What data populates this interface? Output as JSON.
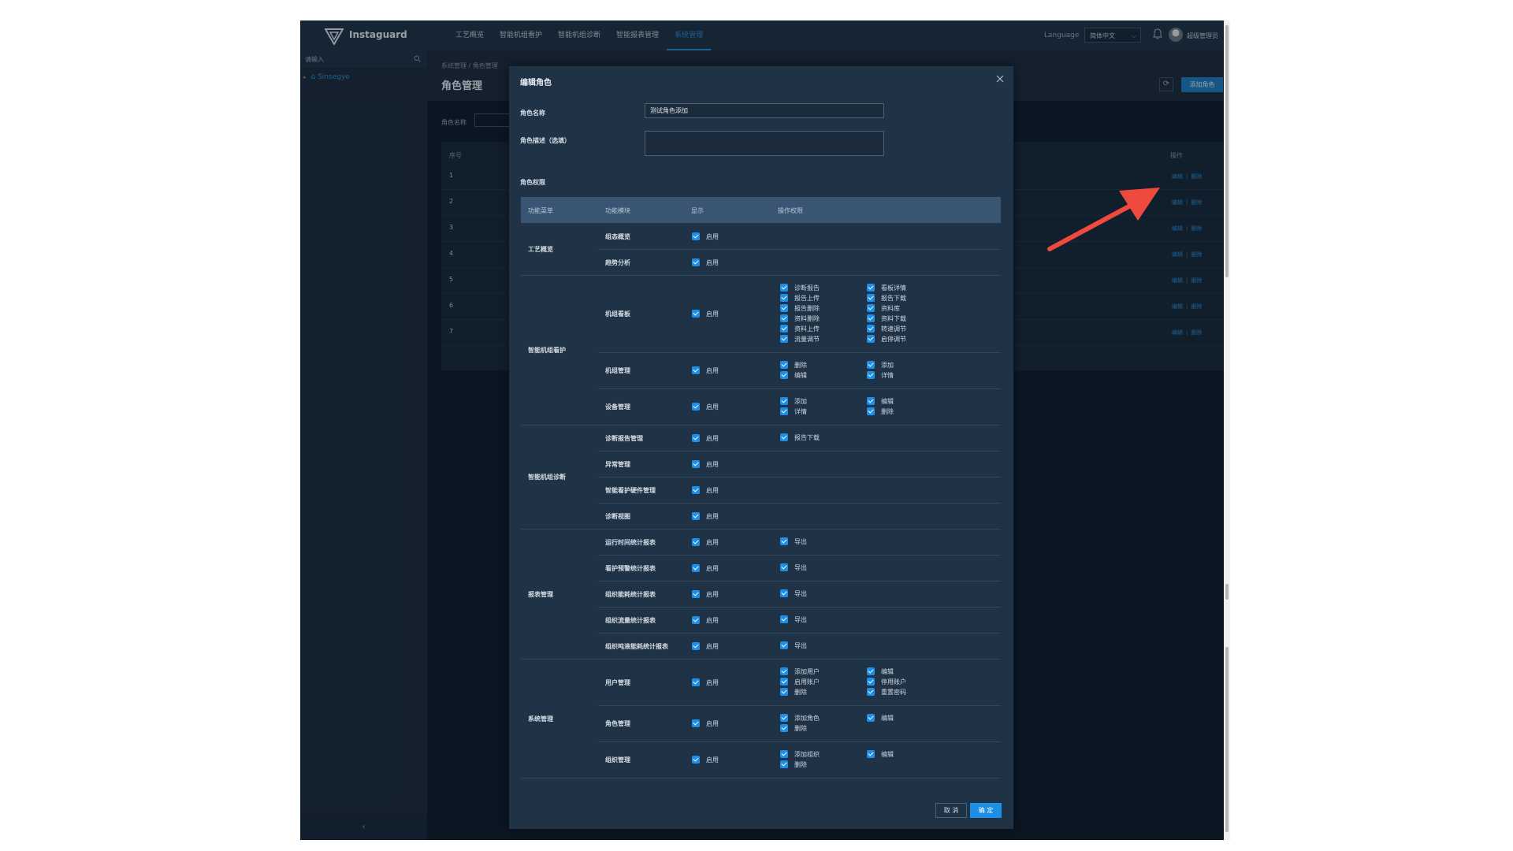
{
  "topbar": {
    "app_name": "Instaguard",
    "nav": [
      "工艺概览",
      "智能机组看护",
      "智能机组诊断",
      "智能报表管理",
      "系统管理"
    ],
    "language_label": "Language",
    "language_value": "简体中文",
    "user_name": "超级管理员"
  },
  "sidebar": {
    "search_placeholder": "请输入",
    "tree_item": "Sinsegye"
  },
  "page": {
    "breadcrumb": "系统管理 / 角色管理",
    "title": "角色管理",
    "add_role_button": "添加角色",
    "filter_label": "角色名称",
    "table": {
      "col_index": "序号",
      "col_ops": "操作",
      "rows": [
        "1",
        "2",
        "3",
        "4",
        "5",
        "6",
        "7"
      ],
      "edit_label": "编辑",
      "delete_label": "删除"
    }
  },
  "modal": {
    "title": "编辑角色",
    "role_name_label": "角色名称",
    "role_name_value": "测试角色添加",
    "role_desc_label": "角色描述（选填）",
    "permissions_label": "角色权限",
    "headers": [
      "功能菜单",
      "功能模块",
      "显示",
      "操作权限"
    ],
    "enable_label": "启用",
    "groups": [
      {
        "name": "工艺概览",
        "modules": [
          {
            "name": "组态概览",
            "ops": []
          },
          {
            "name": "趋势分析",
            "ops": []
          }
        ]
      },
      {
        "name": "智能机组看护",
        "modules": [
          {
            "name": "机组看板",
            "ops": [
              "诊断报告",
              "看板详情",
              "报告上传",
              "报告下载",
              "报告删除",
              "资料库",
              "资料删除",
              "资料下载",
              "资料上传",
              "转速调节",
              "流量调节",
              "启停调节"
            ]
          },
          {
            "name": "机组管理",
            "ops": [
              "删除",
              "添加",
              "编辑",
              "详情"
            ]
          },
          {
            "name": "设备管理",
            "ops": [
              "添加",
              "编辑",
              "详情",
              "删除"
            ]
          }
        ]
      },
      {
        "name": "智能机组诊断",
        "modules": [
          {
            "name": "诊断报告管理",
            "ops": [
              "报告下载"
            ]
          },
          {
            "name": "异常管理",
            "ops": []
          },
          {
            "name": "智能看护硬件管理",
            "ops": []
          },
          {
            "name": "诊断视图",
            "ops": []
          }
        ]
      },
      {
        "name": "报表管理",
        "modules": [
          {
            "name": "运行时间统计报表",
            "ops": [
              "导出"
            ]
          },
          {
            "name": "看护预警统计报表",
            "ops": [
              "导出"
            ]
          },
          {
            "name": "组织能耗统计报表",
            "ops": [
              "导出"
            ]
          },
          {
            "name": "组织流量统计报表",
            "ops": [
              "导出"
            ]
          },
          {
            "name": "组织吨液能耗统计报表",
            "ops": [
              "导出"
            ]
          }
        ]
      },
      {
        "name": "系统管理",
        "modules": [
          {
            "name": "用户管理",
            "ops": [
              "添加用户",
              "编辑",
              "启用账户",
              "停用账户",
              "删除",
              "重置密码"
            ]
          },
          {
            "name": "角色管理",
            "ops": [
              "添加角色",
              "编辑",
              "删除"
            ]
          },
          {
            "name": "组织管理",
            "ops": [
              "添加组织",
              "编辑",
              "删除"
            ]
          }
        ]
      }
    ],
    "cancel_button": "取 消",
    "ok_button": "确 定"
  },
  "colors": {
    "accent": "#1e8fe6",
    "annotation_arrow": "#f04a3e"
  }
}
